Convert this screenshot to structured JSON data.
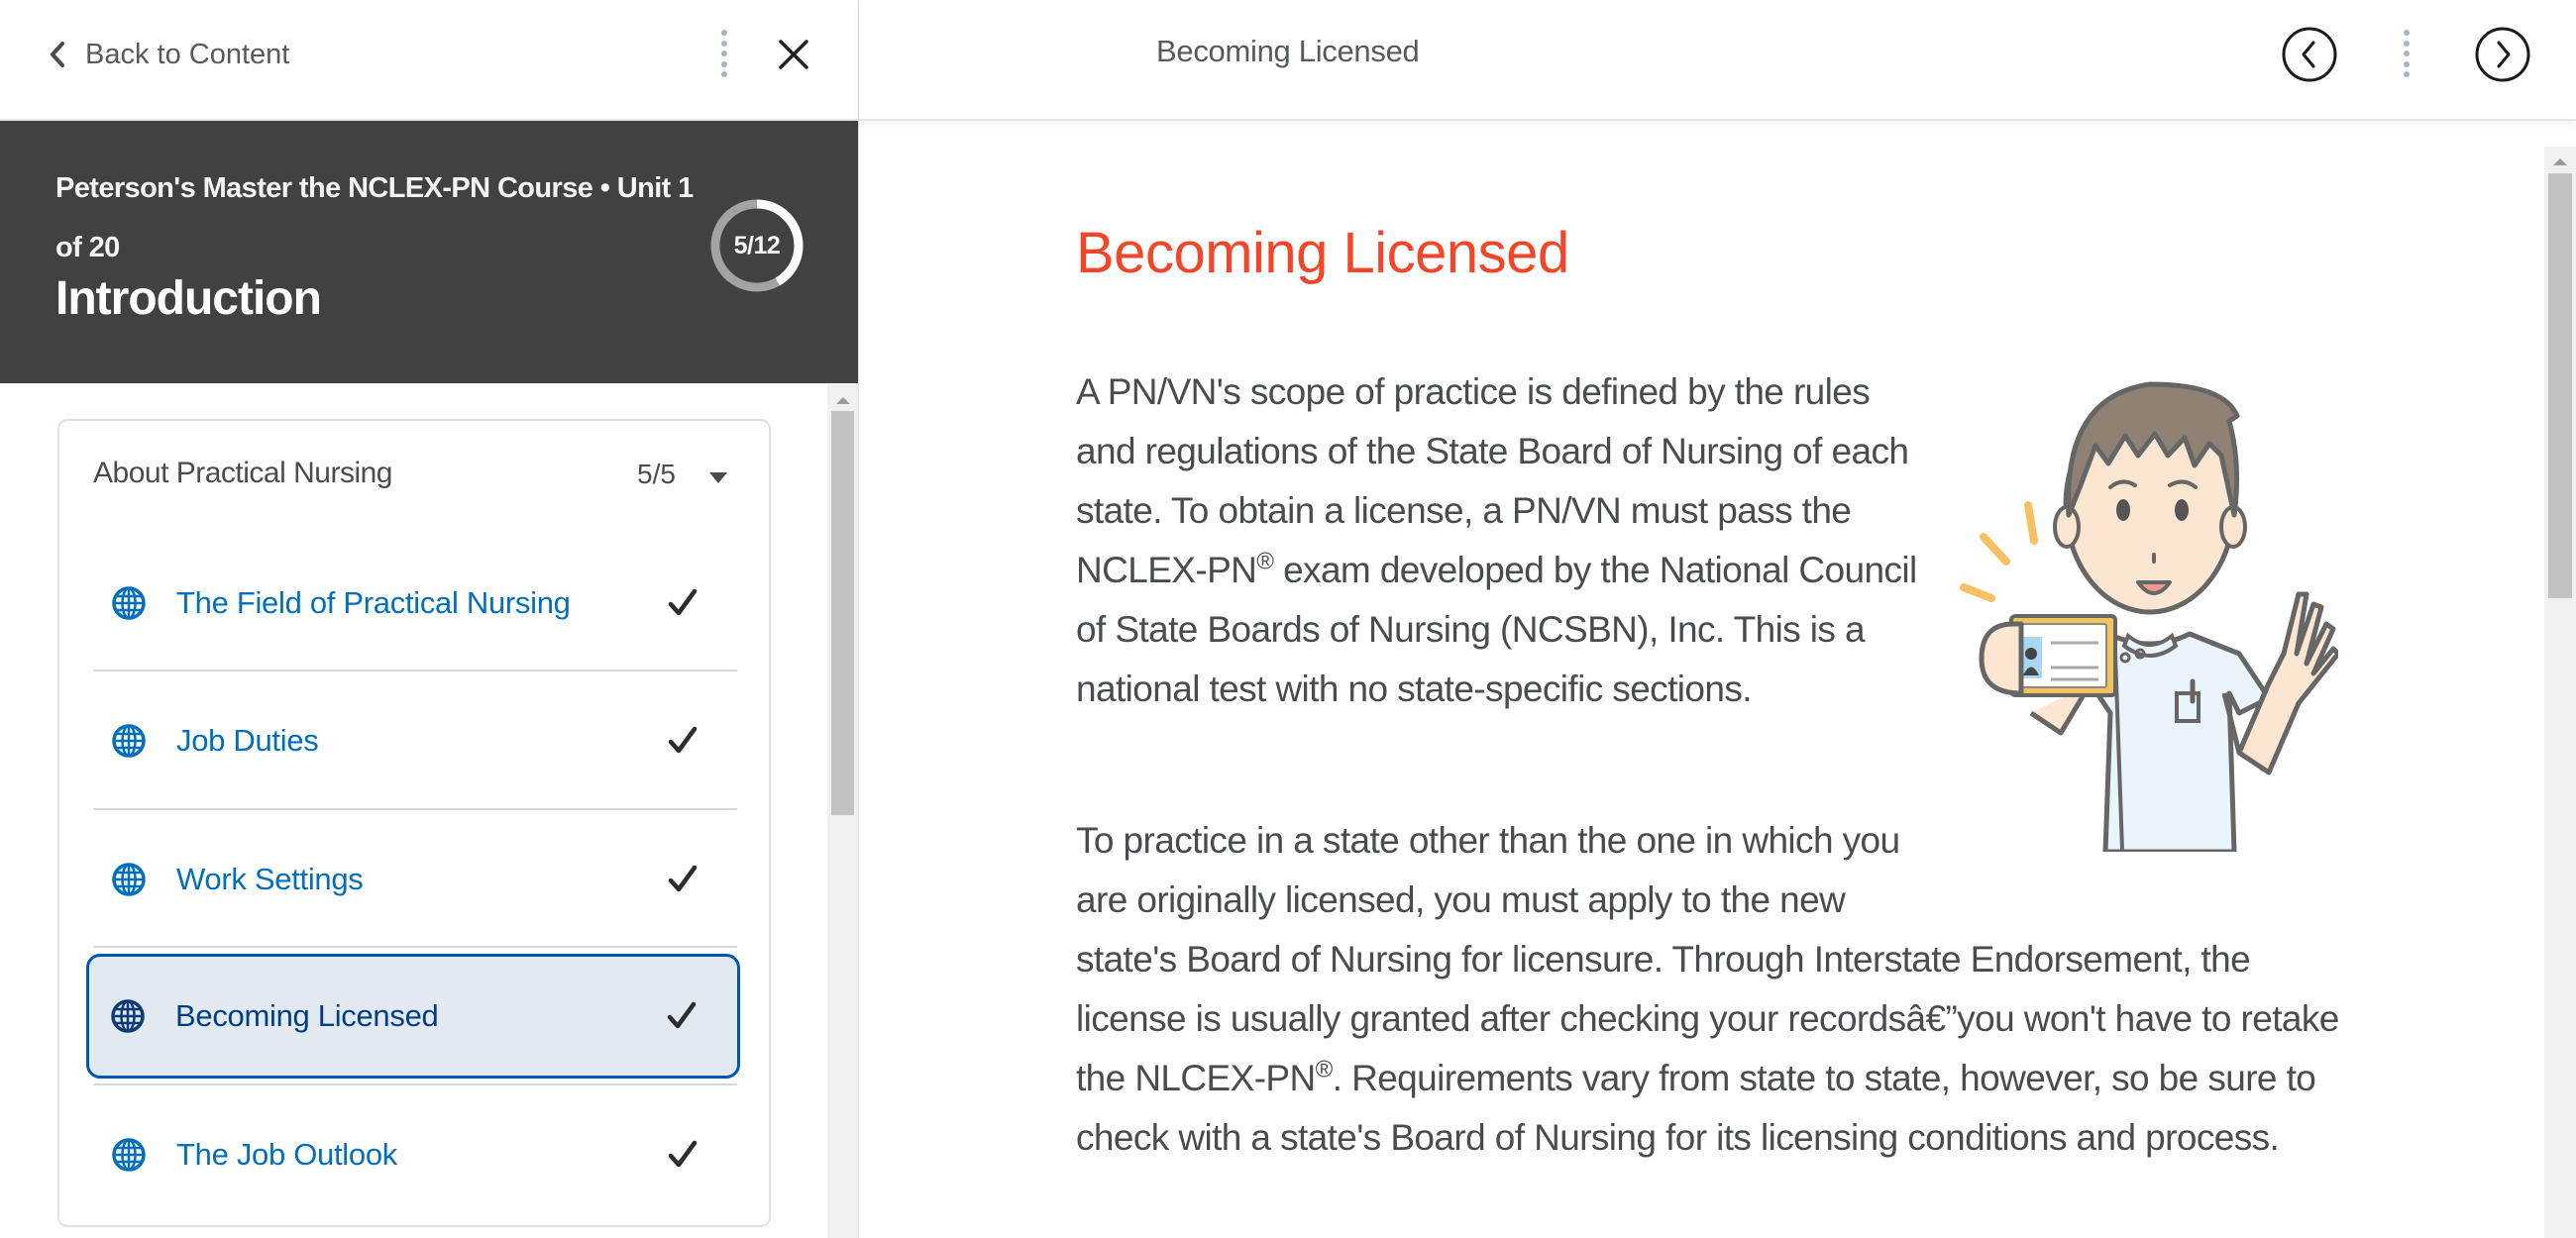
{
  "sidebar": {
    "back_label": "Back to Content",
    "unit_header": {
      "course_line": "Peterson's Master the NCLEX-PN Course  •  Unit 1 of 20",
      "title": "Introduction",
      "progress_label": "5/12",
      "progress_fraction": 0.4167
    },
    "module": {
      "title": "About Practical Nursing",
      "count": "5/5",
      "items": [
        {
          "label": "The Field of Practical Nursing",
          "completed": true,
          "selected": false
        },
        {
          "label": "Job Duties",
          "completed": true,
          "selected": false
        },
        {
          "label": "Work Settings",
          "completed": true,
          "selected": false
        },
        {
          "label": "Becoming Licensed",
          "completed": true,
          "selected": true
        },
        {
          "label": "The Job Outlook",
          "completed": true,
          "selected": false
        }
      ]
    }
  },
  "topbar": {
    "title": "Becoming Licensed",
    "prev_label": "Previous",
    "next_label": "Next"
  },
  "content": {
    "title": "Becoming Licensed",
    "paragraph_1": {
      "before_sup": "A PN/VN's scope of practice is defined by the rules and regulations of the State Board of Nursing of each state. To obtain a license, a PN/VN must pass the NCLEX-PN",
      "sup": "®",
      "after_sup": " exam developed by the National Council of State Boards of Nursing (NCSBN), Inc. This is a national test with no state-specific sections."
    },
    "paragraph_2": {
      "before_sup": "To practice in a state other than the one in which you are originally licensed, you must apply to the new state's Board of Nursing for licensure. Through Interstate Endorsement, the license is usually granted after checking your recordsâ€”you won't have to retake the NLCEX-PN",
      "sup": "®",
      "after_sup": ". Requirements vary from state to state, however, so be sure to check with a state's Board of Nursing for its licensing conditions and process."
    },
    "illustration_alt": "nurse holding license card"
  },
  "colors": {
    "accent_link": "#006fbf",
    "title_red": "#f2452a",
    "header_dark": "#414141",
    "selected_border": "#0057b1",
    "selected_bg": "#e3e9f1"
  }
}
